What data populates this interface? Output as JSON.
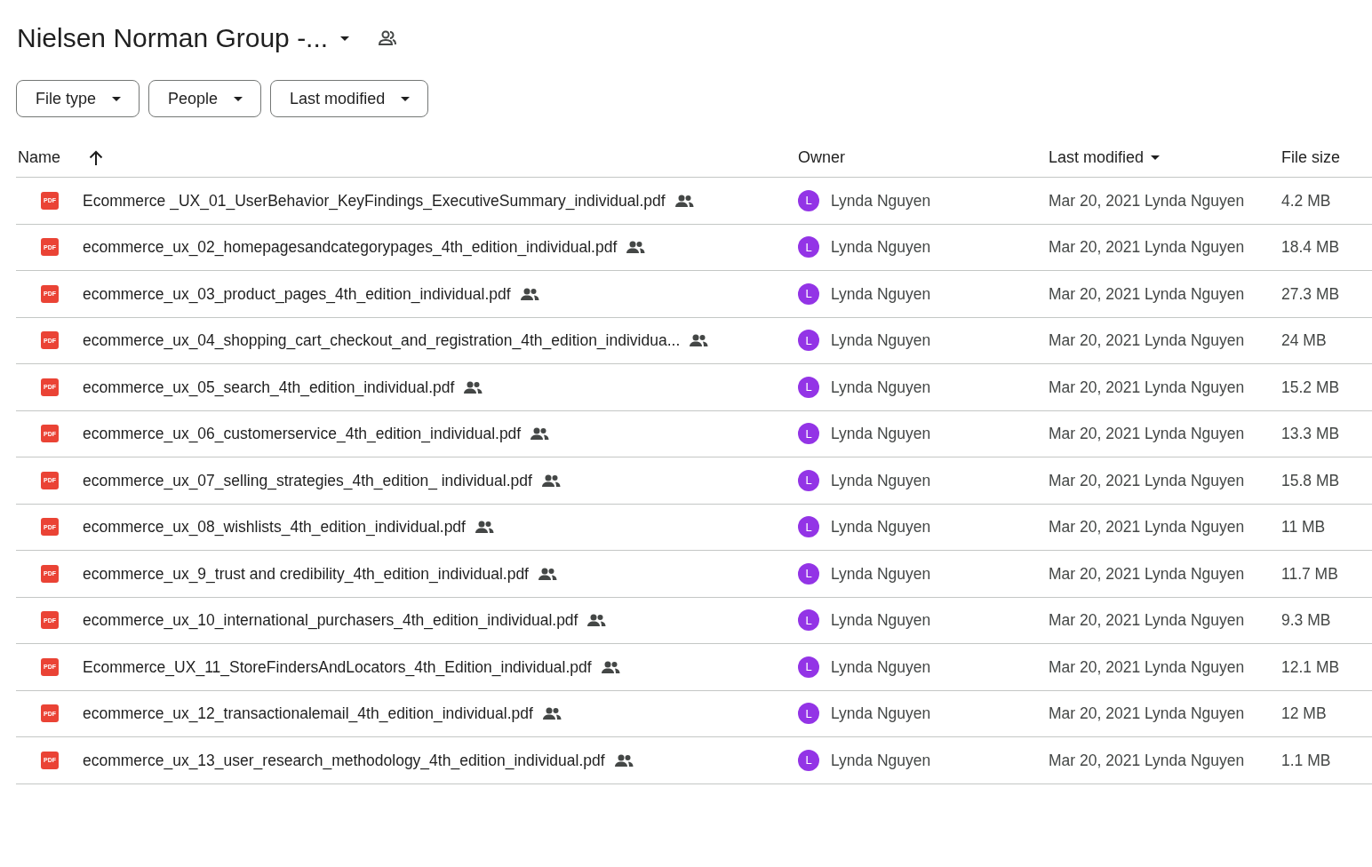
{
  "title": "Nielsen Norman Group -...",
  "filters": [
    {
      "label": "File type"
    },
    {
      "label": "People"
    },
    {
      "label": "Last modified"
    }
  ],
  "columns": [
    {
      "label": "Name",
      "sorted": true,
      "ascending": true
    },
    {
      "label": "Owner",
      "sorted": false
    },
    {
      "label": "Last modified",
      "sorted": true,
      "ascending": false
    },
    {
      "label": "File size",
      "sorted": false
    }
  ],
  "rows": [
    {
      "icon_text": "PDF",
      "name": "Ecommerce _UX_01_UserBehavior_KeyFindings_ExecutiveSummary_individual.pdf",
      "shared": true,
      "avatar": "L",
      "owner": "Lynda Nguyen",
      "modified": "Mar 20, 2021 Lynda Nguyen",
      "size": "4.2 MB"
    },
    {
      "icon_text": "PDF",
      "name": "ecommerce_ux_02_homepagesandcategorypages_4th_edition_individual.pdf",
      "shared": true,
      "avatar": "L",
      "owner": "Lynda Nguyen",
      "modified": "Mar 20, 2021 Lynda Nguyen",
      "size": "18.4 MB"
    },
    {
      "icon_text": "PDF",
      "name": "ecommerce_ux_03_product_pages_4th_edition_individual.pdf",
      "shared": true,
      "avatar": "L",
      "owner": "Lynda Nguyen",
      "modified": "Mar 20, 2021 Lynda Nguyen",
      "size": "27.3 MB"
    },
    {
      "icon_text": "PDF",
      "name": "ecommerce_ux_04_shopping_cart_checkout_and_registration_4th_edition_individua...",
      "shared": true,
      "avatar": "L",
      "owner": "Lynda Nguyen",
      "modified": "Mar 20, 2021 Lynda Nguyen",
      "size": "24 MB"
    },
    {
      "icon_text": "PDF",
      "name": "ecommerce_ux_05_search_4th_edition_individual.pdf",
      "shared": true,
      "avatar": "L",
      "owner": "Lynda Nguyen",
      "modified": "Mar 20, 2021 Lynda Nguyen",
      "size": "15.2 MB"
    },
    {
      "icon_text": "PDF",
      "name": "ecommerce_ux_06_customerservice_4th_edition_individual.pdf",
      "shared": true,
      "avatar": "L",
      "owner": "Lynda Nguyen",
      "modified": "Mar 20, 2021 Lynda Nguyen",
      "size": "13.3 MB"
    },
    {
      "icon_text": "PDF",
      "name": "ecommerce_ux_07_selling_strategies_4th_edition_ individual.pdf",
      "shared": true,
      "avatar": "L",
      "owner": "Lynda Nguyen",
      "modified": "Mar 20, 2021 Lynda Nguyen",
      "size": "15.8 MB"
    },
    {
      "icon_text": "PDF",
      "name": "ecommerce_ux_08_wishlists_4th_edition_individual.pdf",
      "shared": true,
      "avatar": "L",
      "owner": "Lynda Nguyen",
      "modified": "Mar 20, 2021 Lynda Nguyen",
      "size": "11 MB"
    },
    {
      "icon_text": "PDF",
      "name": "ecommerce_ux_9_trust and credibility_4th_edition_individual.pdf",
      "shared": true,
      "avatar": "L",
      "owner": "Lynda Nguyen",
      "modified": "Mar 20, 2021 Lynda Nguyen",
      "size": "11.7 MB"
    },
    {
      "icon_text": "PDF",
      "name": "ecommerce_ux_10_international_purchasers_4th_edition_individual.pdf",
      "shared": true,
      "avatar": "L",
      "owner": "Lynda Nguyen",
      "modified": "Mar 20, 2021 Lynda Nguyen",
      "size": "9.3 MB"
    },
    {
      "icon_text": "PDF",
      "name": "Ecommerce_UX_11_StoreFindersAndLocators_4th_Edition_individual.pdf",
      "shared": true,
      "avatar": "L",
      "owner": "Lynda Nguyen",
      "modified": "Mar 20, 2021 Lynda Nguyen",
      "size": "12.1 MB"
    },
    {
      "icon_text": "PDF",
      "name": "ecommerce_ux_12_transactionalemail_4th_edition_individual.pdf",
      "shared": true,
      "avatar": "L",
      "owner": "Lynda Nguyen",
      "modified": "Mar 20, 2021 Lynda Nguyen",
      "size": "12 MB"
    },
    {
      "icon_text": "PDF",
      "name": "ecommerce_ux_13_user_research_methodology_4th_edition_individual.pdf",
      "shared": true,
      "avatar": "L",
      "owner": "Lynda Nguyen",
      "modified": "Mar 20, 2021 Lynda Nguyen",
      "size": "1.1 MB"
    }
  ]
}
